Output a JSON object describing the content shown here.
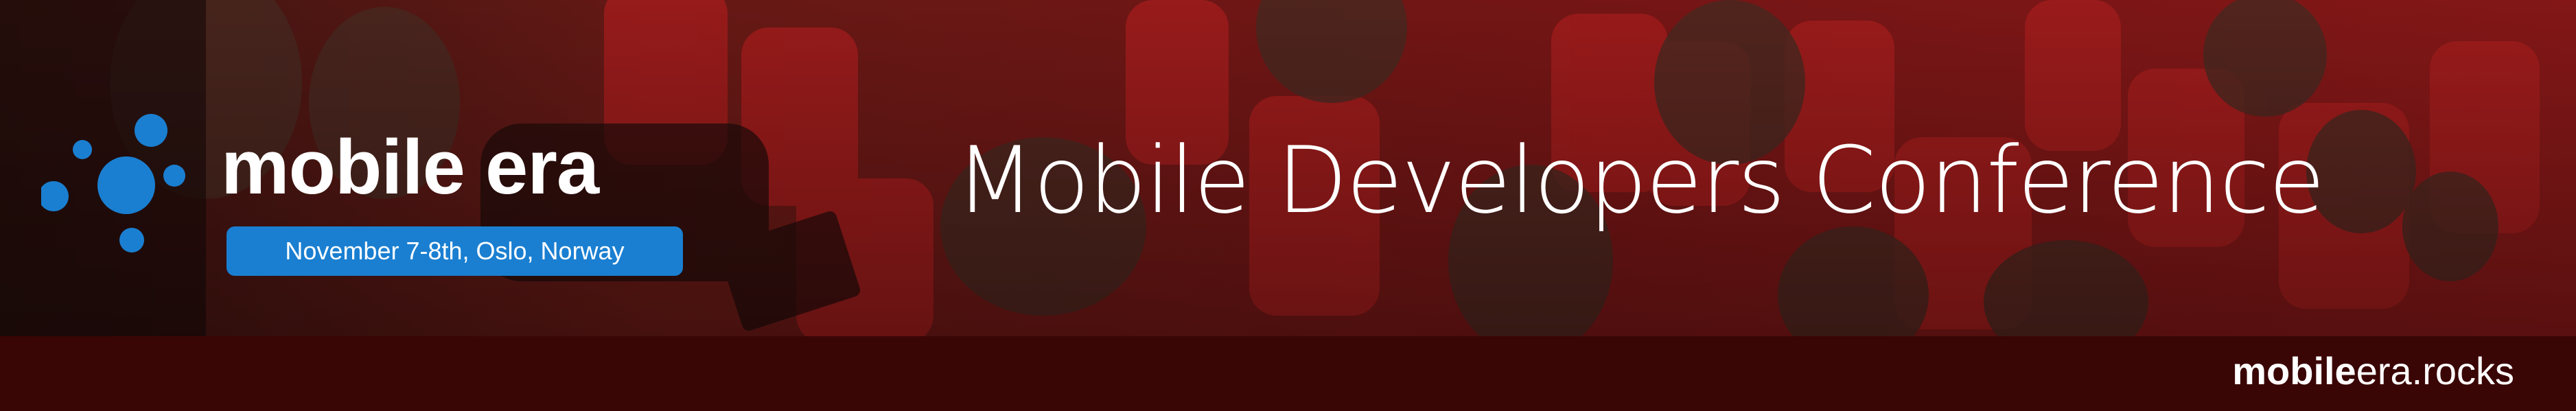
{
  "logo": {
    "wordmark": "mobile era",
    "date_line": "November 7-8th, Oslo, Norway",
    "dots_icon": "dot-cluster-icon"
  },
  "headline": "Mobile Developers Conference",
  "footer": {
    "site_bold": "mobile",
    "site_rest": "era.rocks"
  },
  "colors": {
    "accent_blue": "#1a7fd1",
    "overlay_red": "#8a1212",
    "footer_bar": "#3a0505",
    "text": "#ffffff"
  }
}
